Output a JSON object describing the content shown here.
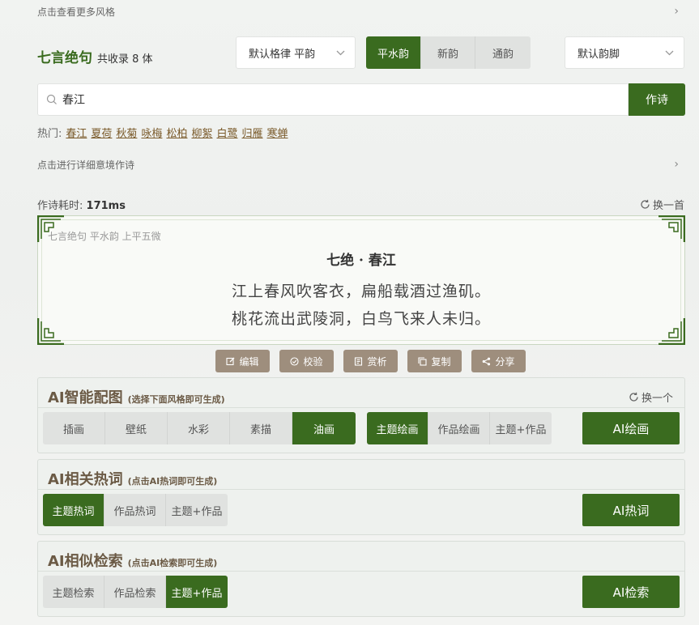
{
  "more_styles": "点击查看更多风格",
  "header": {
    "title": "七言绝句",
    "count": "共收录 8 体"
  },
  "format_select": {
    "value": "默认格律 平韵"
  },
  "rhyme_tabs": [
    {
      "label": "平水韵",
      "active": true
    },
    {
      "label": "新韵",
      "active": false
    },
    {
      "label": "通韵",
      "active": false
    }
  ],
  "rhyme_foot_select": {
    "value": "默认韵脚"
  },
  "search": {
    "value": "春江",
    "button": "作诗"
  },
  "hot": {
    "label": "热门:",
    "items": [
      "春江",
      "夏荷",
      "秋菊",
      "咏梅",
      "松柏",
      "柳絮",
      "白鹭",
      "归雁",
      "寒蝉"
    ]
  },
  "detailed_link": "点击进行详细意境作诗",
  "meta": {
    "time_label": "作诗耗时:",
    "time_value": "171ms",
    "refresh": "换一首"
  },
  "poem": {
    "subtitle": "七言绝句 平水韵 上平五微",
    "title": "七绝 · 春江",
    "lines": [
      "江上春风吹客衣，扁船载酒过渔矶。",
      "桃花流出武陵洞，白鸟飞来人未归。"
    ]
  },
  "actions": [
    {
      "icon": "edit-icon",
      "label": "编辑"
    },
    {
      "icon": "check-circle-icon",
      "label": "校验"
    },
    {
      "icon": "book-icon",
      "label": "赏析"
    },
    {
      "icon": "copy-icon",
      "label": "复制"
    },
    {
      "icon": "share-icon",
      "label": "分享"
    }
  ],
  "ai_image": {
    "title": "AI智能配图",
    "note": "(选择下面风格即可生成)",
    "refresh": "换一个",
    "styles": [
      {
        "label": "插画",
        "active": false
      },
      {
        "label": "壁纸",
        "active": false
      },
      {
        "label": "水彩",
        "active": false
      },
      {
        "label": "素描",
        "active": false
      },
      {
        "label": "油画",
        "active": true
      }
    ],
    "modes": [
      {
        "label": "主题绘画",
        "active": true
      },
      {
        "label": "作品绘画",
        "active": false
      },
      {
        "label": "主题+作品",
        "active": false
      }
    ],
    "button": "AI绘画"
  },
  "ai_hot": {
    "title": "AI相关热词",
    "note": "(点击AI热词即可生成)",
    "modes": [
      {
        "label": "主题热词",
        "active": true
      },
      {
        "label": "作品热词",
        "active": false
      },
      {
        "label": "主题+作品",
        "active": false
      }
    ],
    "button": "AI热词"
  },
  "ai_search": {
    "title": "AI相似检索",
    "note": "(点击AI检索即可生成)",
    "modes": [
      {
        "label": "主题检索",
        "active": false
      },
      {
        "label": "作品检索",
        "active": false
      },
      {
        "label": "主题+作品",
        "active": true
      }
    ],
    "button": "AI检索"
  },
  "colors": {
    "accent": "#3a6b1f",
    "action_button": "#9e8e7d",
    "card_title": "#6b5a45"
  }
}
